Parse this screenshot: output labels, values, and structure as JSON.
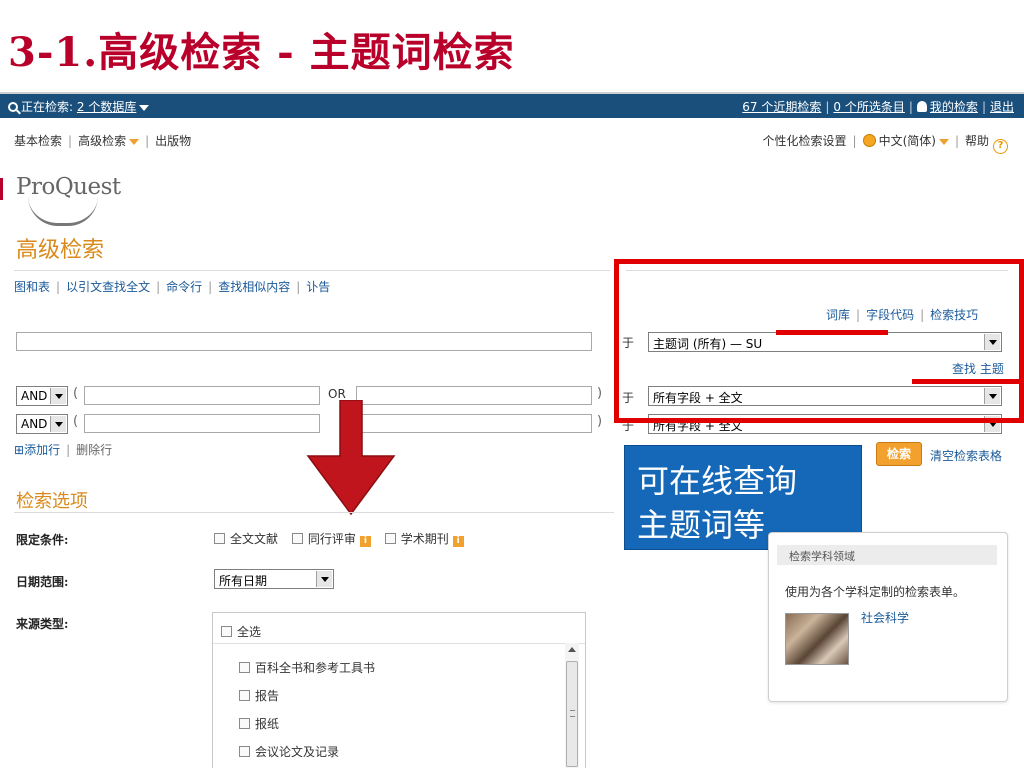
{
  "slide": {
    "title": "3-1.高级检索  - 主题词检索"
  },
  "topbar": {
    "searching_label": "正在检索:",
    "databases_link": "2 个数据库",
    "recent_searches": "67 个近期检索",
    "selected_items": "0 个所选条目",
    "my_search": "我的检索",
    "logout": "退出"
  },
  "subnav": {
    "basic_search": "基本检索",
    "advanced_search": "高级检索",
    "publications": "出版物",
    "personalize": "个性化检索设置",
    "language": "中文(简体)",
    "help": "帮助"
  },
  "logo": "ProQuest",
  "page_heading": "高级检索",
  "tool_links": [
    "图和表",
    "以引文查找全文",
    "命令行",
    "查找相似内容",
    "讣告"
  ],
  "help_links": [
    "词库",
    "字段代码",
    "检索技巧"
  ],
  "rows": {
    "in_label": "于",
    "field1": "主题词 (所有) — SU",
    "find_subject": "查找 主题",
    "operator": "AND",
    "or_label": "OR",
    "field2": "所有字段 + 全文",
    "field3": "所有字段 + 全文"
  },
  "add_row": "添加行",
  "delete_row": "删除行",
  "callout": {
    "line1": "可在线查询",
    "line2": "主题词等"
  },
  "search_button": "检索",
  "clear_form": "清空检索表格",
  "options": {
    "heading": "检索选项",
    "limit_label": "限定条件:",
    "limits": [
      "全文文献",
      "同行评审",
      "学术期刊"
    ],
    "date_label": "日期范围:",
    "date_value": "所有日期",
    "source_label": "来源类型:",
    "select_all": "全选",
    "sources": [
      "百科全书和参考工具书",
      "报告",
      "报纸",
      "会议论文及记录"
    ]
  },
  "subject_panel": {
    "header": "检索学科领域",
    "description": "使用为各个学科定制的检索表单。",
    "link": "社会科学"
  },
  "colors": {
    "title_red": "#b8002a",
    "topbar_blue": "#1a4f7c",
    "accent_orange": "#d98a1a",
    "highlight_red": "#e00000",
    "callout_blue": "#1568b8"
  }
}
